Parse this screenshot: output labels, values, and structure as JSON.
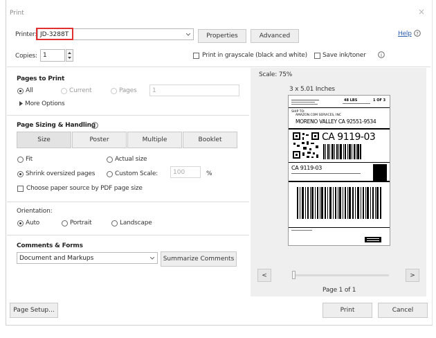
{
  "window": {
    "title": "Print",
    "close_glyph": "×"
  },
  "printer": {
    "label": "Printer:",
    "value": "JD-3288T",
    "properties": "Properties",
    "advanced": "Advanced",
    "help": "Help"
  },
  "copies": {
    "label": "Copies:",
    "value": "1"
  },
  "options": {
    "grayscale": "Print in grayscale (black and white)",
    "save_ink": "Save ink/toner"
  },
  "pages_to_print": {
    "heading": "Pages to Print",
    "all": "All",
    "current": "Current",
    "pages": "Pages",
    "pages_value": "1",
    "more_options": "More Options"
  },
  "sizing": {
    "heading": "Page Sizing & Handling",
    "tabs": [
      "Size",
      "Poster",
      "Multiple",
      "Booklet"
    ],
    "fit": "Fit",
    "actual_size": "Actual size",
    "shrink": "Shrink oversized pages",
    "custom_scale": "Custom Scale:",
    "scale_value": "100",
    "percent": "%",
    "paper_source": "Choose paper source by PDF page size"
  },
  "orientation": {
    "heading": "Orientation:",
    "auto": "Auto",
    "portrait": "Portrait",
    "landscape": "Landscape"
  },
  "comments": {
    "heading": "Comments & Forms",
    "value": "Document and Markups",
    "summarize": "Summarize Comments"
  },
  "preview": {
    "scale": "Scale: 75%",
    "size": "3 x 5.01 Inches",
    "page_counter": "Page 1 of 1",
    "prev": "<",
    "next": ">"
  },
  "shipping_label": {
    "weight": "48 LBS",
    "pieces": "1 OF 3",
    "ship_to": "SHIP TO:",
    "company": "AMAZON.COM SERVICES, INC",
    "city": "MORENO VALLEY CA 92551-9534",
    "route_large": "CA 9119-03",
    "route_small": "CA 9119-03"
  },
  "footer": {
    "page_setup": "Page Setup...",
    "print": "Print",
    "cancel": "Cancel"
  }
}
